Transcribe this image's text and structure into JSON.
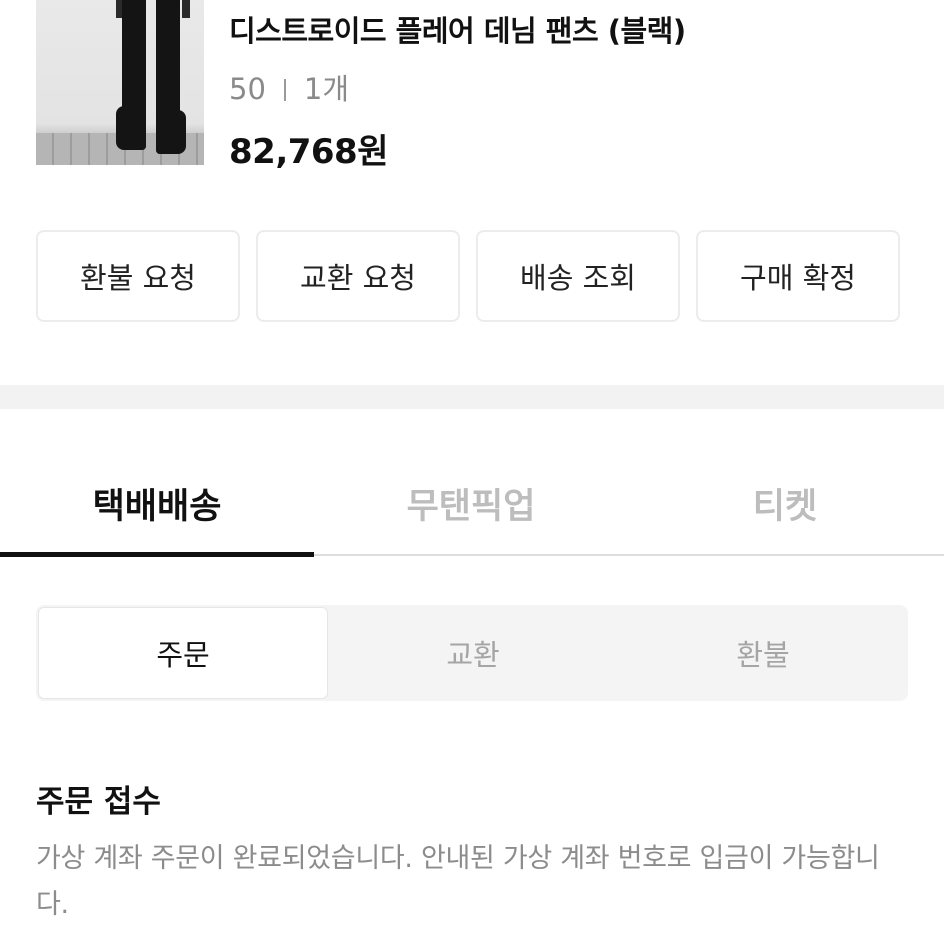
{
  "product": {
    "name": "디스트로이드 플레어 데님 팬츠 (블랙)",
    "size": "50",
    "quantity": "1개",
    "price": "82,768원"
  },
  "actions": [
    "환불 요청",
    "교환 요청",
    "배송 조회",
    "구매 확정"
  ],
  "delivery_tabs": {
    "items": [
      "택배배송",
      "무탠픽업",
      "티켓"
    ],
    "active": "택배배송"
  },
  "order_segments": {
    "items": [
      "주문",
      "교환",
      "환불"
    ],
    "active": "주문"
  },
  "status": {
    "title": "주문 접수",
    "description": "가상 계좌 주문이 완료되었습니다. 안내된 가상 계좌 번호로 입금이 가능합니다."
  }
}
